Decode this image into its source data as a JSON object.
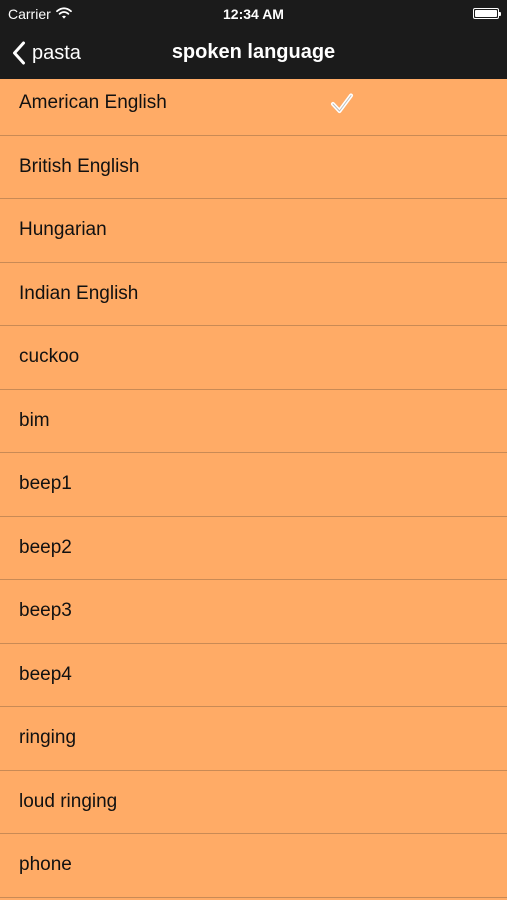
{
  "status_bar": {
    "carrier": "Carrier",
    "time": "12:34 AM"
  },
  "nav": {
    "back_label": "pasta",
    "title": "spoken language"
  },
  "list": {
    "items": [
      {
        "label": "American English",
        "selected": true
      },
      {
        "label": "British English",
        "selected": false
      },
      {
        "label": "Hungarian",
        "selected": false
      },
      {
        "label": "Indian English",
        "selected": false
      },
      {
        "label": "cuckoo",
        "selected": false
      },
      {
        "label": "bim",
        "selected": false
      },
      {
        "label": "beep1",
        "selected": false
      },
      {
        "label": "beep2",
        "selected": false
      },
      {
        "label": "beep3",
        "selected": false
      },
      {
        "label": "beep4",
        "selected": false
      },
      {
        "label": "ringing",
        "selected": false
      },
      {
        "label": "loud ringing",
        "selected": false
      },
      {
        "label": "phone",
        "selected": false
      }
    ]
  },
  "colors": {
    "bar_background": "#1b1b1b",
    "list_background": "#ffab66",
    "separator": "#c98a55"
  }
}
